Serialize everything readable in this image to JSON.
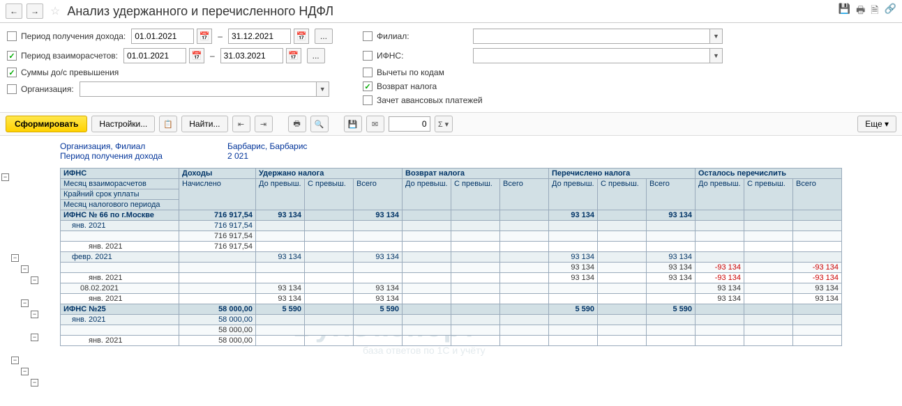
{
  "title": "Анализ удержанного и перечисленного НДФЛ",
  "nav": {
    "back": "←",
    "forward": "→"
  },
  "filters": {
    "income_period_label": "Период получения дохода:",
    "income_period_from": "01.01.2021",
    "income_period_to": "31.12.2021",
    "settle_period_label": "Период взаиморасчетов:",
    "settle_period_from": "01.01.2021",
    "settle_period_to": "31.03.2021",
    "sums_label": "Суммы до/с превышения",
    "org_label": "Организация:",
    "branch_label": "Филиал:",
    "ifns_label": "ИФНС:",
    "deduct_label": "Вычеты по кодам",
    "refund_label": "Возврат налога",
    "advance_label": "Зачет авансовых платежей"
  },
  "toolbar": {
    "form": "Сформировать",
    "settings": "Настройки...",
    "find": "Найти...",
    "num": "0",
    "more": "Еще"
  },
  "report_info": {
    "org_label": "Организация, Филиал",
    "org_value": "Барбарис, Барбарис",
    "period_label": "Период получения дохода",
    "period_value": "2 021"
  },
  "headers": {
    "ifns": "ИФНС",
    "month_settle": "Месяц взаиморасчетов",
    "deadline": "Крайний срок уплаты",
    "tax_month": "Месяц налогового периода",
    "income": "Доходы",
    "accrued": "Начислено",
    "withheld": "Удержано налога",
    "before": "До превыш.",
    "after": "С превыш.",
    "total": "Всего",
    "refund": "Возврат налога",
    "transferred": "Перечислено налога",
    "remaining": "Осталось перечислить"
  },
  "rows": [
    {
      "cls": "row-bold",
      "c0": "ИФНС № 66 по г.Москве",
      "c1": "716 917,54",
      "c2": "93 134",
      "c3": "",
      "c4": "93 134",
      "c5": "",
      "c6": "",
      "c7": "",
      "c8": "93 134",
      "c9": "",
      "c10": "93 134",
      "c11": "",
      "c12": "",
      "c13": ""
    },
    {
      "cls": "row-sub",
      "c0": "янв. 2021",
      "c1": "716 917,54",
      "c2": "",
      "c3": "",
      "c4": "",
      "c5": "",
      "c6": "",
      "c7": "",
      "c8": "",
      "c9": "",
      "c10": "",
      "c11": "",
      "c12": "",
      "c13": ""
    },
    {
      "cls": "row-lt",
      "c0": "",
      "c1": "716 917,54",
      "c2": "",
      "c3": "",
      "c4": "",
      "c5": "",
      "c6": "",
      "c7": "",
      "c8": "",
      "c9": "",
      "c10": "",
      "c11": "",
      "c12": "",
      "c13": ""
    },
    {
      "cls": "",
      "c0": "янв. 2021",
      "c1": "716 917,54",
      "c2": "",
      "c3": "",
      "c4": "",
      "c5": "",
      "c6": "",
      "c7": "",
      "c8": "",
      "c9": "",
      "c10": "",
      "c11": "",
      "c12": "",
      "c13": ""
    },
    {
      "cls": "row-sub",
      "c0": "февр. 2021",
      "c1": "",
      "c2": "93 134",
      "c3": "",
      "c4": "93 134",
      "c5": "",
      "c6": "",
      "c7": "",
      "c8": "93 134",
      "c9": "",
      "c10": "93 134",
      "c11": "",
      "c12": "",
      "c13": ""
    },
    {
      "cls": "row-lt",
      "c0": "",
      "c1": "",
      "c2": "",
      "c3": "",
      "c4": "",
      "c5": "",
      "c6": "",
      "c7": "",
      "c8": "93 134",
      "c9": "",
      "c10": "93 134",
      "c11": "-93 134",
      "c12": "",
      "c13": "-93 134"
    },
    {
      "cls": "",
      "c0": "янв. 2021",
      "c1": "",
      "c2": "",
      "c3": "",
      "c4": "",
      "c5": "",
      "c6": "",
      "c7": "",
      "c8": "93 134",
      "c9": "",
      "c10": "93 134",
      "c11": "-93 134",
      "c12": "",
      "c13": "-93 134"
    },
    {
      "cls": "row-lt",
      "c0": "08.02.2021",
      "c1": "",
      "c2": "93 134",
      "c3": "",
      "c4": "93 134",
      "c5": "",
      "c6": "",
      "c7": "",
      "c8": "",
      "c9": "",
      "c10": "",
      "c11": "93 134",
      "c12": "",
      "c13": "93 134"
    },
    {
      "cls": "",
      "c0": "янв. 2021",
      "c1": "",
      "c2": "93 134",
      "c3": "",
      "c4": "93 134",
      "c5": "",
      "c6": "",
      "c7": "",
      "c8": "",
      "c9": "",
      "c10": "",
      "c11": "93 134",
      "c12": "",
      "c13": "93 134"
    },
    {
      "cls": "row-bold",
      "c0": "ИФНС №25",
      "c1": "58 000,00",
      "c2": "5 590",
      "c3": "",
      "c4": "5 590",
      "c5": "",
      "c6": "",
      "c7": "",
      "c8": "5 590",
      "c9": "",
      "c10": "5 590",
      "c11": "",
      "c12": "",
      "c13": ""
    },
    {
      "cls": "row-sub",
      "c0": "янв. 2021",
      "c1": "58 000,00",
      "c2": "",
      "c3": "",
      "c4": "",
      "c5": "",
      "c6": "",
      "c7": "",
      "c8": "",
      "c9": "",
      "c10": "",
      "c11": "",
      "c12": "",
      "c13": ""
    },
    {
      "cls": "row-lt",
      "c0": "",
      "c1": "58 000,00",
      "c2": "",
      "c3": "",
      "c4": "",
      "c5": "",
      "c6": "",
      "c7": "",
      "c8": "",
      "c9": "",
      "c10": "",
      "c11": "",
      "c12": "",
      "c13": ""
    },
    {
      "cls": "",
      "c0": "янв. 2021",
      "c1": "58 000,00",
      "c2": "",
      "c3": "",
      "c4": "",
      "c5": "",
      "c6": "",
      "c7": "",
      "c8": "",
      "c9": "",
      "c10": "",
      "c11": "",
      "c12": "",
      "c13": ""
    }
  ],
  "watermark": "БухЭксперт",
  "watermark_sub": "база ответов по 1С и учёту"
}
